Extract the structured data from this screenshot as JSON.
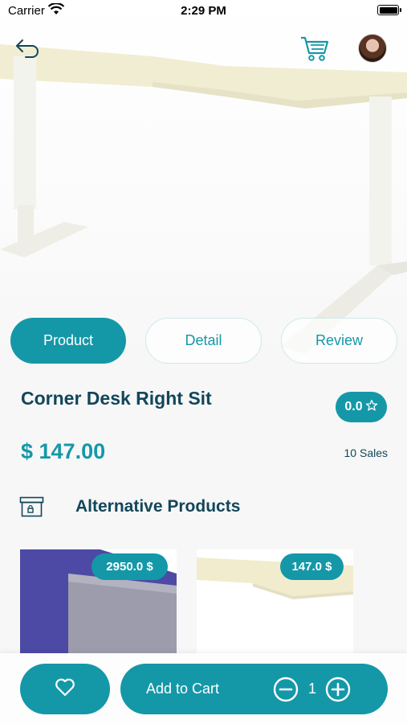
{
  "status_bar": {
    "carrier": "Carrier",
    "time": "2:29 PM"
  },
  "header": {
    "back_icon": "back-arrow-icon",
    "cart_icon": "shopping-cart-icon",
    "avatar": "user-avatar"
  },
  "tabs": [
    {
      "label": "Product",
      "active": true
    },
    {
      "label": "Detail",
      "active": false
    },
    {
      "label": "Review",
      "active": false
    }
  ],
  "product": {
    "name": "Corner Desk Right Sit",
    "rating": "0.0",
    "price": "$ 147.00",
    "sales": "10 Sales"
  },
  "alternatives": {
    "title": "Alternative Products",
    "items": [
      {
        "price": "2950.0 $"
      },
      {
        "price": "147.0 $"
      }
    ]
  },
  "actions": {
    "add_to_cart": "Add to Cart",
    "quantity": "1"
  },
  "colors": {
    "accent": "#1498a8",
    "heading": "#12465a"
  }
}
